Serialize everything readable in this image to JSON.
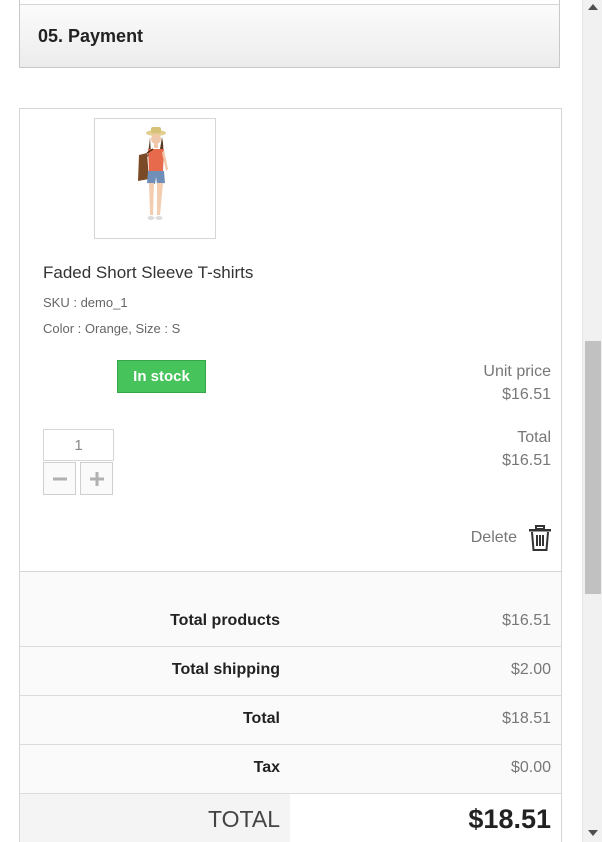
{
  "step": {
    "title": "05. Payment"
  },
  "product": {
    "name": "Faded Short Sleeve T-shirts",
    "sku": "SKU : demo_1",
    "attributes": "Color : Orange, Size : S",
    "stock_status": "In stock",
    "unit_price_label": "Unit price",
    "unit_price": "$16.51",
    "quantity": "1",
    "total_label": "Total",
    "total": "$16.51",
    "delete_label": "Delete",
    "image_icon": "product-photo-woman-icon",
    "stock_color": "#46c35a"
  },
  "totals": {
    "rows": [
      {
        "label": "Total products",
        "value": "$16.51"
      },
      {
        "label": "Total shipping",
        "value": "$2.00"
      },
      {
        "label": "Total",
        "value": "$18.51"
      },
      {
        "label": "Tax",
        "value": "$0.00"
      }
    ],
    "grand_label": "TOTAL",
    "grand_value": "$18.51"
  }
}
